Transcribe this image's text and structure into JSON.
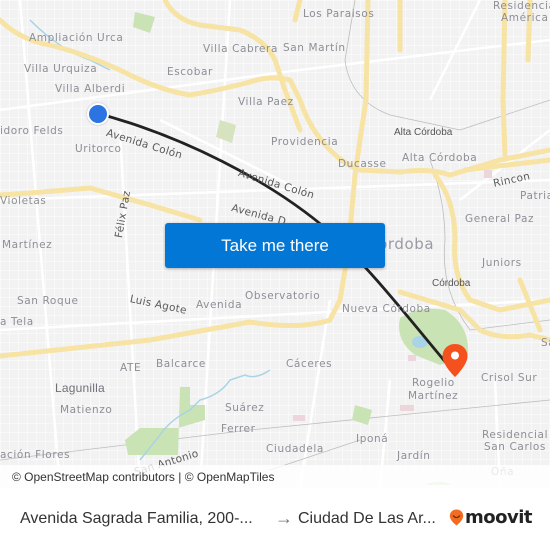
{
  "map": {
    "labels": {
      "ampliacion_urca": "Ampliación Urca",
      "villa_cabrera": "Villa Cabrera",
      "san_martin": "San Martín",
      "los_paraisos": "Los Paraisos",
      "residencial_america_1": "Residencial",
      "residencial_america_2": "América",
      "villa_urquiza": "Villa Urquiza",
      "escobar": "Escobar",
      "villa_alberdi": "Villa Alberdi",
      "villa_paez": "Villa Paez",
      "isidoro_felds": "idoro Felds",
      "uritorco": "Uritorco",
      "providencia": "Providencia",
      "alta_cordoba_small": "Alta Córdoba",
      "alta_cordoba": "Alta Córdoba",
      "ducasse": "Ducasse",
      "rincon": "Rincon",
      "patria": "Patria",
      "violetas": "Violetas",
      "general_paz": "General Paz",
      "martinez": "Martínez",
      "cordoba_big": "Córdoba",
      "juniors": "Juniors",
      "cordoba_small": "Córdoba",
      "san_roque": "San Roque",
      "a_tela": "a Tela",
      "observatorio": "Observatorio",
      "nueva_cordoba": "Nueva Córdoba",
      "s_right": "Sa",
      "balcarce": "Balcarce",
      "ate": "ATE",
      "caceres": "Cáceres",
      "rogelio_1": "Rogelio",
      "rogelio_2": "Martínez",
      "crisol_sur": "Crisol Sur",
      "lagunilla": "Lagunilla",
      "matienzo": "Matienzo",
      "suarez": "Suárez",
      "ferrer": "Ferrer",
      "residencial_san_carlos_1": "Residencial",
      "residencial_san_carlos_2": "San Carlos",
      "ipona": "Iponá",
      "ciudadela": "Ciudadela",
      "jardin": "Jardín",
      "estacion_flores": "ación Flores",
      "ona": "Oña"
    },
    "roads": {
      "avenida_colon_1": "Avenida Colón",
      "avenida_colon_2": "Avenida Colón",
      "avenida_d": "Avenida D",
      "felix_paz": "Félix Paz",
      "luis_agote": "Luis Agote",
      "avenida": "Avenida",
      "san_antonio": "San Antonio"
    },
    "colors": {
      "route": "#222222",
      "origin": "#2b74e2",
      "destination": "#f4511e",
      "major_road": "#fbe7a6",
      "park": "#b9e0a5"
    }
  },
  "cta": {
    "label": "Take me there"
  },
  "attribution": {
    "text": "© OpenStreetMap contributors | © OpenMapTiles"
  },
  "footer": {
    "from": "Avenida Sagrada Familia, 200-...",
    "arrow": "→",
    "to": "Ciudad De Las Ar...",
    "brand": "moovit",
    "brand_color": "#f26c21"
  }
}
